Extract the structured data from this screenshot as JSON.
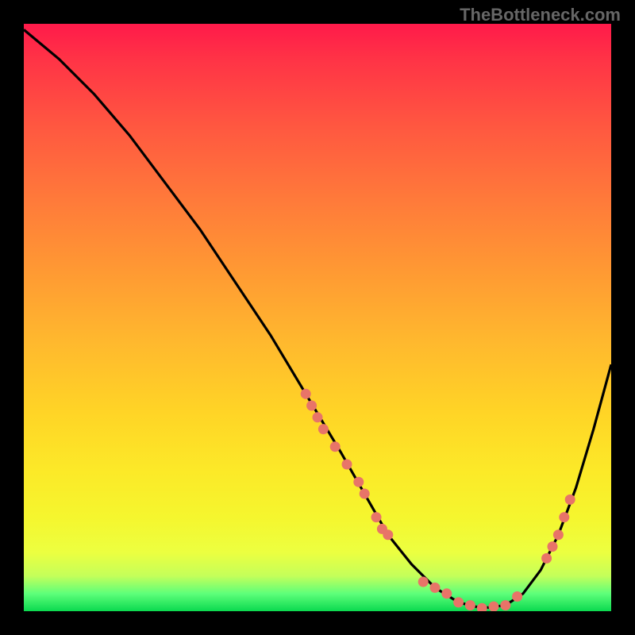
{
  "watermark": "TheBottleneck.com",
  "chart_data": {
    "type": "line",
    "title": "",
    "xlabel": "",
    "ylabel": "",
    "xlim": [
      0,
      100
    ],
    "ylim": [
      0,
      100
    ],
    "gradient_colors": {
      "top": "#ff1a4a",
      "mid_upper": "#ff9933",
      "mid_lower": "#fce928",
      "bottom": "#0bd94f"
    },
    "series": [
      {
        "name": "bottleneck-curve",
        "color": "#000000",
        "x": [
          0,
          6,
          12,
          18,
          24,
          30,
          36,
          42,
          48,
          54,
          58,
          62,
          66,
          70,
          74,
          78,
          82,
          85,
          88,
          91,
          94,
          97,
          100
        ],
        "y": [
          99,
          94,
          88,
          81,
          73,
          65,
          56,
          47,
          37,
          27,
          20,
          13,
          8,
          4,
          1.5,
          0.5,
          1,
          3,
          7,
          13,
          21,
          31,
          42
        ]
      }
    ],
    "markers": [
      {
        "name": "marker-cluster-left",
        "color": "#e87468",
        "points": [
          {
            "x": 48,
            "y": 37
          },
          {
            "x": 49,
            "y": 35
          },
          {
            "x": 50,
            "y": 33
          },
          {
            "x": 51,
            "y": 31
          },
          {
            "x": 53,
            "y": 28
          },
          {
            "x": 55,
            "y": 25
          },
          {
            "x": 57,
            "y": 22
          },
          {
            "x": 58,
            "y": 20
          },
          {
            "x": 60,
            "y": 16
          },
          {
            "x": 61,
            "y": 14
          },
          {
            "x": 62,
            "y": 13
          }
        ]
      },
      {
        "name": "marker-cluster-bottom",
        "color": "#e87468",
        "points": [
          {
            "x": 68,
            "y": 5
          },
          {
            "x": 70,
            "y": 4
          },
          {
            "x": 72,
            "y": 3
          },
          {
            "x": 74,
            "y": 1.5
          },
          {
            "x": 76,
            "y": 1
          },
          {
            "x": 78,
            "y": 0.5
          },
          {
            "x": 80,
            "y": 0.8
          },
          {
            "x": 82,
            "y": 1
          },
          {
            "x": 84,
            "y": 2.5
          }
        ]
      },
      {
        "name": "marker-cluster-right",
        "color": "#e87468",
        "points": [
          {
            "x": 89,
            "y": 9
          },
          {
            "x": 90,
            "y": 11
          },
          {
            "x": 91,
            "y": 13
          },
          {
            "x": 92,
            "y": 16
          },
          {
            "x": 93,
            "y": 19
          }
        ]
      }
    ]
  }
}
